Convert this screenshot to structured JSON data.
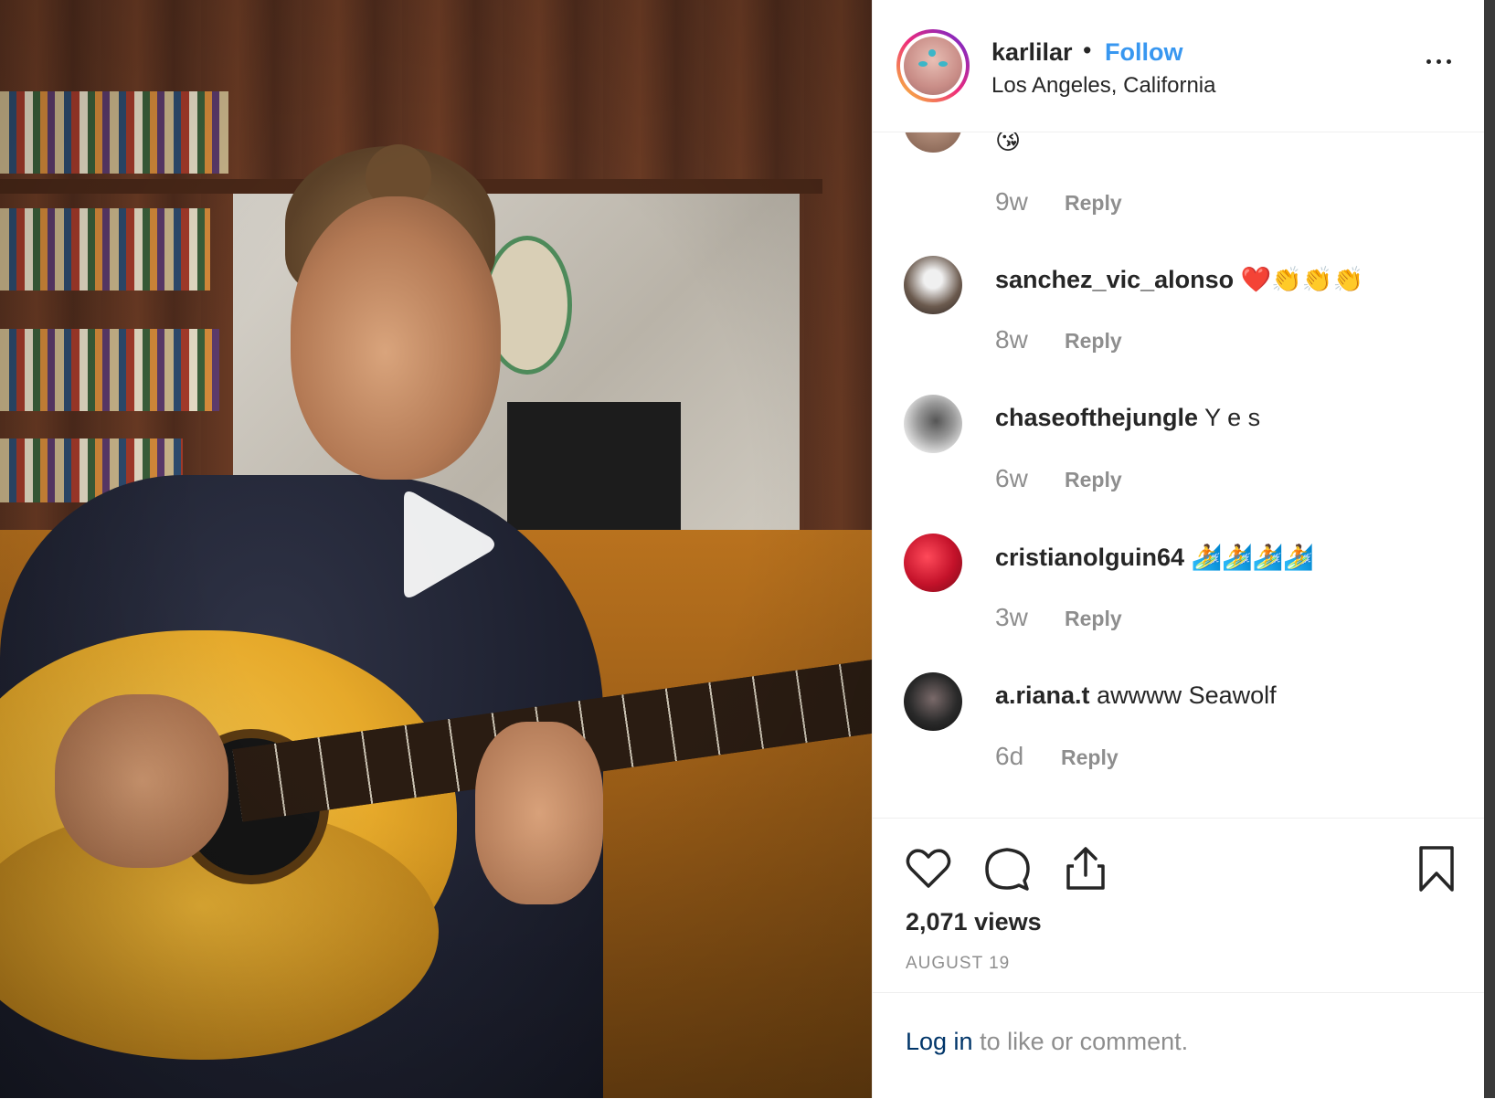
{
  "video": {
    "play_icon": "play-icon"
  },
  "header": {
    "username": "karlilar",
    "separator": "•",
    "follow_label": "Follow",
    "location": "Los Angeles, California",
    "more_icon": "more-horizontal-icon"
  },
  "comments": [
    {
      "user": "",
      "text": "",
      "emoji": "😘",
      "time": "9w",
      "reply": "Reply"
    },
    {
      "user": "sanchez_vic_alonso",
      "text": "",
      "emoji": "❤️👏👏👏",
      "time": "8w",
      "reply": "Reply"
    },
    {
      "user": "chaseofthejungle",
      "text": "Y e s",
      "emoji": "",
      "time": "6w",
      "reply": "Reply"
    },
    {
      "user": "cristianolguin64",
      "text": "",
      "emoji": "🏄🏄🏄🏄",
      "time": "3w",
      "reply": "Reply"
    },
    {
      "user": "a.riana.t",
      "text": "awwww Seawolf",
      "emoji": "",
      "time": "6d",
      "reply": "Reply"
    }
  ],
  "actions": {
    "like_icon": "heart-icon",
    "comment_icon": "comment-icon",
    "share_icon": "share-icon",
    "save_icon": "bookmark-icon",
    "views": "2,071 views",
    "date": "AUGUST 19"
  },
  "login": {
    "link": "Log in",
    "rest": " to like or comment."
  },
  "colors": {
    "accent": "#3897f0",
    "muted": "#8e8e8e",
    "text": "#262626",
    "link_dark": "#003569"
  }
}
